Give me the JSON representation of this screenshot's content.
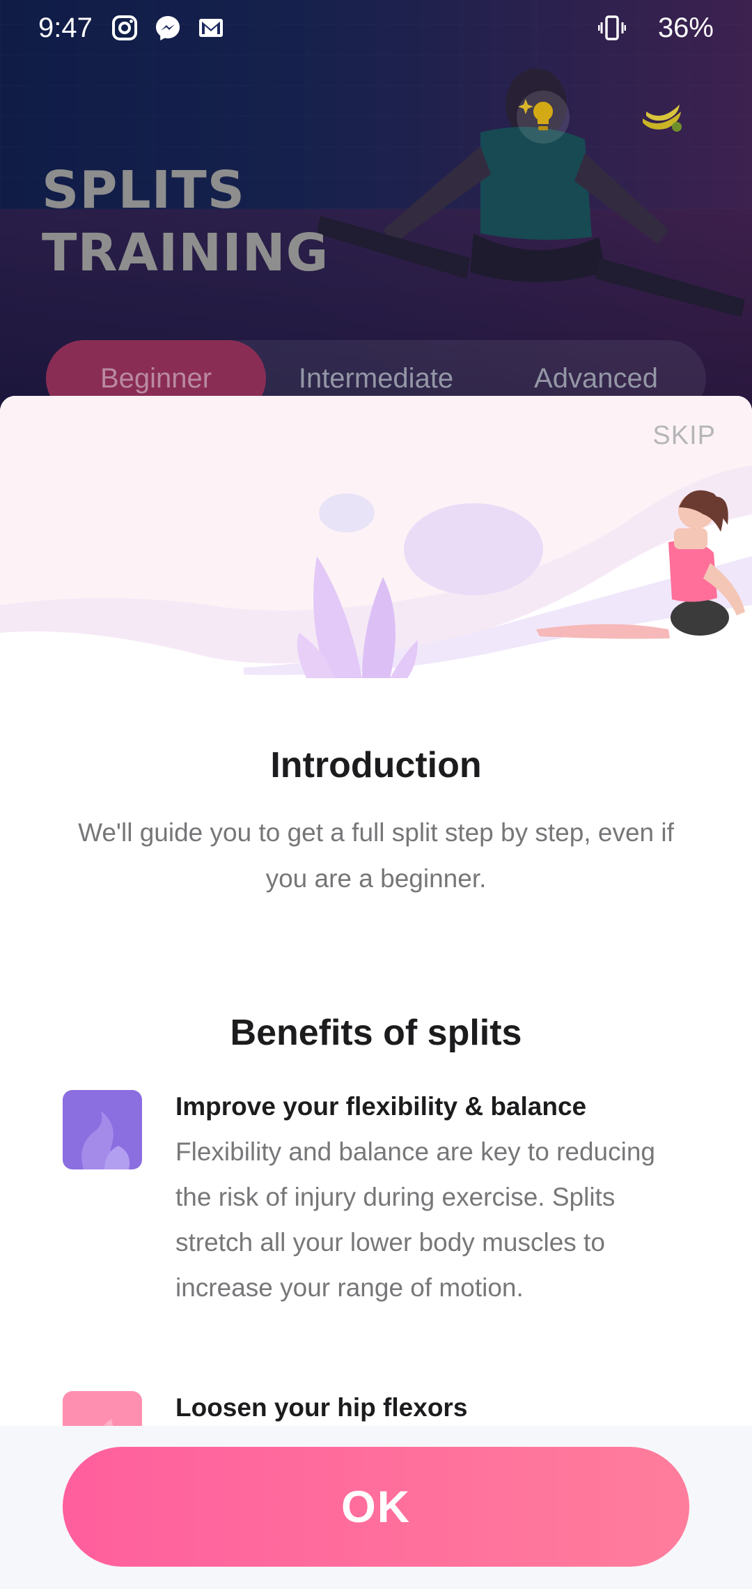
{
  "status_bar": {
    "time": "9:47",
    "battery": "36%",
    "icons": [
      "instagram-icon",
      "messenger-icon",
      "gmail-icon",
      "vibrate-icon"
    ]
  },
  "background": {
    "title_line1": "SPLITS",
    "title_line2": "TRAINING",
    "tabs": [
      {
        "label": "Beginner",
        "active": true
      },
      {
        "label": "Intermediate",
        "active": false
      },
      {
        "label": "Advanced",
        "active": false
      }
    ]
  },
  "sheet": {
    "skip_label": "SKIP",
    "intro": {
      "title": "Introduction",
      "text": "We'll guide you to get a full split step by step, even if you are a beginner."
    },
    "benefits": {
      "title": "Benefits of splits",
      "items": [
        {
          "heading": "Improve your flexibility & balance",
          "description": "Flexibility and balance are key to reducing the risk of injury during exercise. Splits stretch all your lower body muscles to increase your range of motion.",
          "thumb_color": "#8b6ee0"
        },
        {
          "heading": "Loosen your hip flexors",
          "thumb_color": "#ff8fb0"
        }
      ]
    },
    "ok_label": "OK"
  },
  "colors": {
    "accent": "#ff6a9e",
    "tab_active": "#8a2d55"
  }
}
